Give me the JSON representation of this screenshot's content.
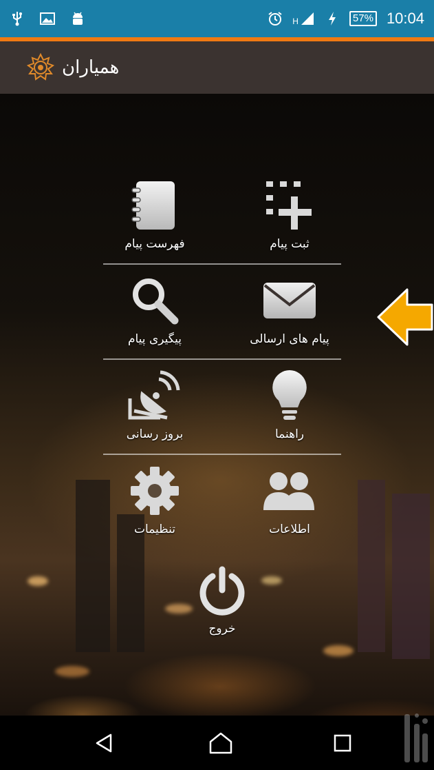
{
  "status_bar": {
    "signal_type": "H",
    "battery_percent": "57%",
    "time": "10:04",
    "icons": [
      "usb-icon",
      "image-icon",
      "android-icon",
      "alarm-icon",
      "signal-icon",
      "charging-icon",
      "battery-icon"
    ]
  },
  "app_bar": {
    "title": "همیاران",
    "logo": "tehran-municipality-logo"
  },
  "menu": {
    "rows": [
      [
        {
          "label": "فهرست پیام",
          "icon": "notebook-icon"
        },
        {
          "label": "ثبت پیام",
          "icon": "add-grid-icon"
        }
      ],
      [
        {
          "label": "پیگیری پیام",
          "icon": "search-icon"
        },
        {
          "label": "پیام های ارسالی",
          "icon": "envelope-icon"
        }
      ],
      [
        {
          "label": "بروز رسانی",
          "icon": "satellite-dish-icon"
        },
        {
          "label": "راهنما",
          "icon": "lightbulb-icon"
        }
      ],
      [
        {
          "label": "تنظیمات",
          "icon": "gear-icon"
        },
        {
          "label": "اطلاعات",
          "icon": "users-icon"
        }
      ]
    ],
    "exit": {
      "label": "خروج",
      "icon": "power-icon"
    }
  },
  "annotation": {
    "icon": "left-arrow-icon",
    "color": "#f5a800"
  },
  "nav_bar": {
    "icons": [
      "back-icon",
      "home-icon",
      "recents-icon"
    ]
  },
  "colors": {
    "status_bar": "#1a7fa8",
    "accent_line": "#f07a12",
    "app_bar": "#3b3330",
    "icon_fill": "#d9d9d9"
  }
}
